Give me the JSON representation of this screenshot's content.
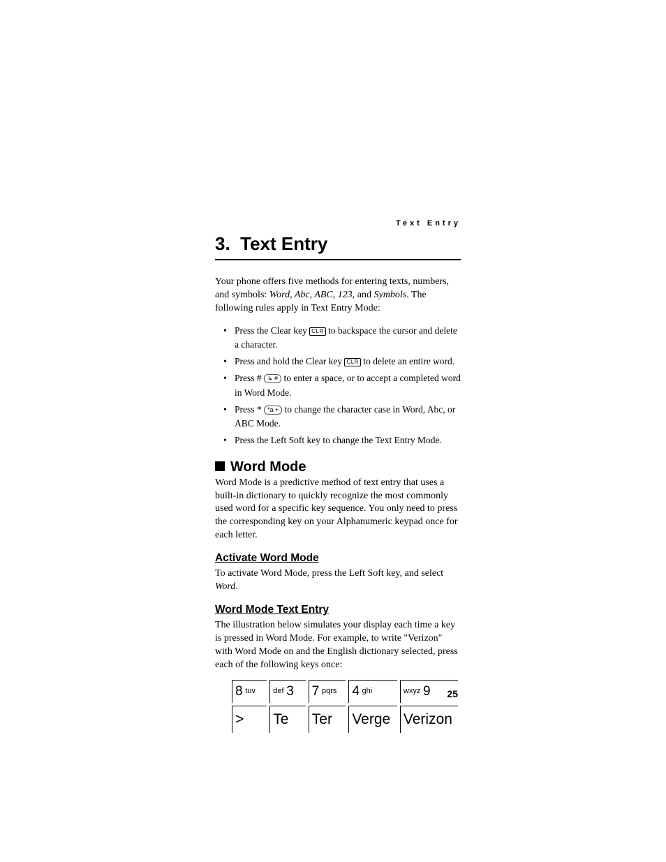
{
  "running_head": "Text Entry",
  "chapter": {
    "number": "3.",
    "title": "Text Entry"
  },
  "intro": {
    "lead": "Your phone offers five methods for entering texts, numbers, and symbols: ",
    "modes": "Word, Abc, ABC, 123",
    "mid": ", and ",
    "modes2": "Symbols",
    "tail": ". The following rules apply in Text Entry Mode:"
  },
  "bullets": {
    "b1a": "Press the Clear key ",
    "b1b": " to backspace the cursor and delete a character.",
    "b2a": "Press and hold the Clear key ",
    "b2b": " to delete an entire word.",
    "b3a": "Press # ",
    "b3b": " to enter a space, or to accept a completed word in Word Mode.",
    "b4a": "Press * ",
    "b4b": " to change the character case in Word, Abc, or ABC Mode.",
    "b5": "Press the Left Soft key to change the Text Entry Mode."
  },
  "key_labels": {
    "clr": "CLR",
    "hash": "↳ #",
    "star": "*a +"
  },
  "word_mode": {
    "heading": "Word Mode",
    "body": "Word Mode is a predictive method of text entry that uses a built-in dictionary to quickly recognize the most commonly used word for a specific key sequence. You only need to press the corresponding key on your Alphanumeric keypad once for each letter."
  },
  "activate": {
    "heading": "Activate Word Mode",
    "body_a": "To activate Word Mode, press the Left Soft key, and select ",
    "body_em": "Word",
    "body_b": "."
  },
  "entry": {
    "heading": "Word Mode Text Entry",
    "body": "The illustration below simulates your display each time a key is pressed in Word Mode. For example, to write \"Verizon\" with Word Mode on and the English dictionary selected, press each of the following keys once:"
  },
  "table": {
    "keys": [
      {
        "big": "8",
        "small": "tuv",
        "big_first": true
      },
      {
        "big": "3",
        "small": "def",
        "big_first": false
      },
      {
        "big": "7",
        "small": "pqrs",
        "big_first": true
      },
      {
        "big": "4",
        "small": "ghi",
        "big_first": true
      },
      {
        "big": "9",
        "small": "wxyz",
        "big_first": false
      }
    ],
    "display": [
      ">",
      "Te",
      "Ter",
      "Verge",
      "Verizon"
    ]
  },
  "page_number": "25"
}
